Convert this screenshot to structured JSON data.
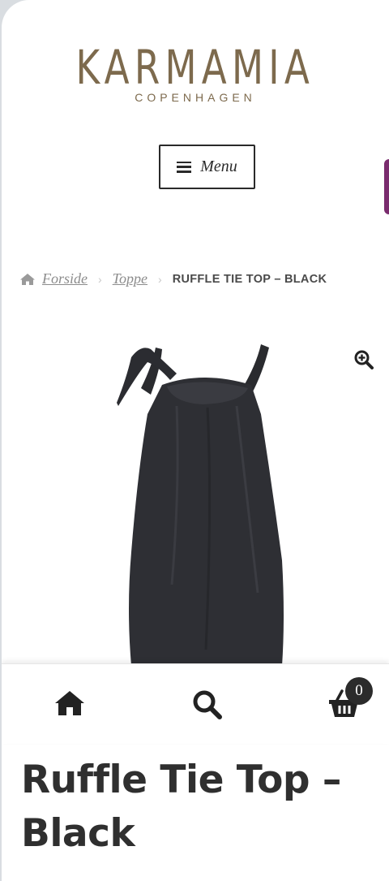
{
  "brand": {
    "name": "KARMAMIA",
    "tagline": "COPENHAGEN"
  },
  "menu": {
    "label": "Menu"
  },
  "breadcrumb": {
    "items": [
      "Forside",
      "Toppe"
    ],
    "current": "RUFFLE TIE TOP – BLACK"
  },
  "product": {
    "title": "Ruffle Tie Top – Black",
    "image_alt": "Black sleeveless ruffle tie top"
  },
  "footer": {
    "cart_count": "0"
  },
  "colors": {
    "brand": "#7d6a4d",
    "text": "#2f2f2f",
    "accent_tab": "#7a2c6e"
  },
  "icons": {
    "menu": "hamburger-icon",
    "breadcrumb_home": "home-icon",
    "zoom": "zoom-in-icon",
    "footer_home": "home-icon",
    "footer_search": "search-icon",
    "footer_cart": "basket-icon"
  }
}
